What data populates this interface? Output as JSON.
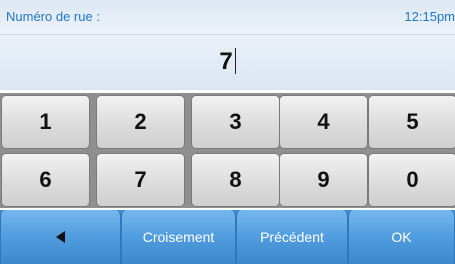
{
  "header": {
    "label": "Numéro de rue :",
    "time": "12:15pm"
  },
  "entry": {
    "value": "7"
  },
  "keypad": {
    "keys": [
      "1",
      "2",
      "3",
      "4",
      "5",
      "6",
      "7",
      "8",
      "9",
      "0"
    ]
  },
  "bottom": {
    "back_icon": "left-arrow-icon",
    "crossing_label": "Croisement",
    "previous_label": "Précédent",
    "ok_label": "OK"
  },
  "colors": {
    "accent_text": "#1f78c8",
    "button_blue": "#4f9cde"
  }
}
